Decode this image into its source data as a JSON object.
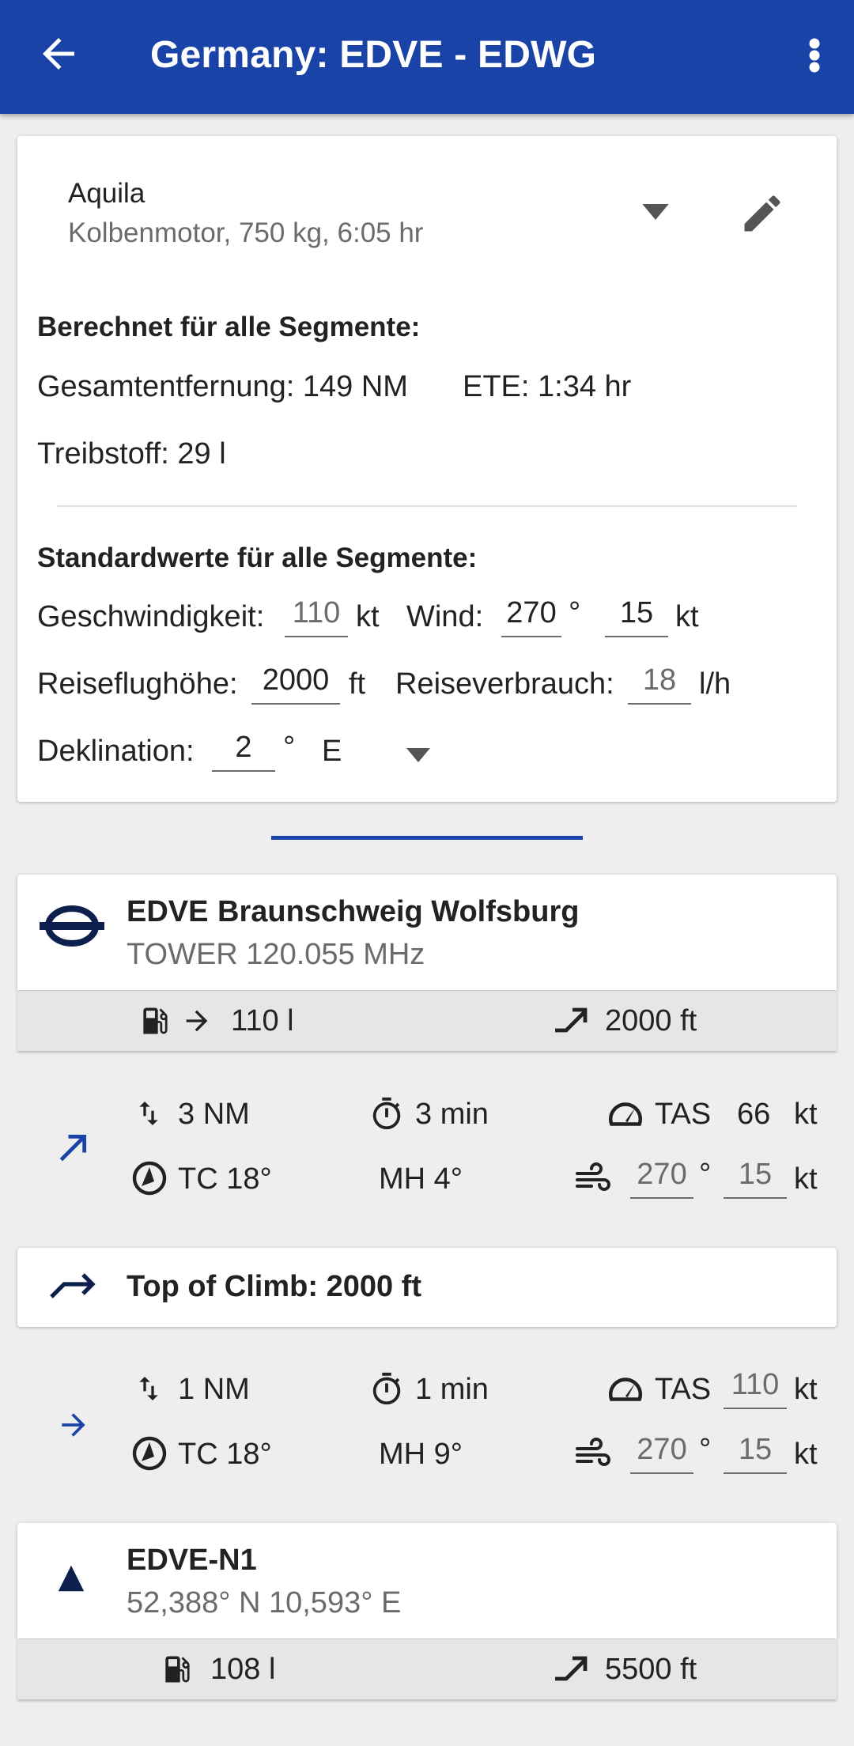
{
  "appbar": {
    "title": "Germany: EDVE - EDWG"
  },
  "aircraft": {
    "name": "Aquila",
    "details": "Kolbenmotor, 750 kg, 6:05 hr"
  },
  "calculated": {
    "heading": "Berechnet für alle Segmente:",
    "distance": "Gesamtentfernung: 149 NM",
    "ete": "ETE: 1:34 hr",
    "fuel": "Treibstoff: 29 l"
  },
  "defaults": {
    "heading": "Standardwerte für alle Segmente:",
    "speed_label": "Geschwindigkeit:",
    "speed_value": "110",
    "speed_unit": "kt",
    "wind_label": "Wind:",
    "wind_dir": "270",
    "wind_dir_unit": "°",
    "wind_speed": "15",
    "wind_speed_unit": "kt",
    "altitude_label": "Reiseflughöhe:",
    "altitude_value": "2000",
    "altitude_unit": "ft",
    "consumption_label": "Reiseverbrauch:",
    "consumption_value": "18",
    "consumption_unit": "l/h",
    "declination_label": "Deklination:",
    "declination_value": "2",
    "declination_unit": "°",
    "declination_dir": "E"
  },
  "waypoints": [
    {
      "code": "EDVE",
      "name": "Braunschweig Wolfsburg",
      "sub": "TOWER 120.055 MHz",
      "fuel": "110 l",
      "altitude": "2000 ft"
    },
    {
      "code": "EDVE-N1",
      "sub": "52,388° N 10,593° E",
      "fuel": "108 l",
      "altitude": "5500 ft"
    }
  ],
  "segments": [
    {
      "distance": "3 NM",
      "time": "3 min",
      "tas_label": "TAS",
      "tas": "66",
      "tas_unit": "kt",
      "tc": "TC 18°",
      "mh": "MH 4°",
      "wind_dir": "270",
      "wind_dir_unit": "°",
      "wind_speed": "15",
      "wind_unit": "kt"
    },
    {
      "distance": "1 NM",
      "time": "1 min",
      "tas_label": "TAS",
      "tas": "110",
      "tas_unit": "kt",
      "tc": "TC 18°",
      "mh": "MH 9°",
      "wind_dir": "270",
      "wind_dir_unit": "°",
      "wind_speed": "15",
      "wind_unit": "kt"
    }
  ],
  "top_of_climb": {
    "label": "Top of Climb: 2000 ft"
  },
  "colors": {
    "primary": "#1a43a8",
    "icon_dark": "#0d1f4d",
    "strip": "#e6e6e6"
  }
}
